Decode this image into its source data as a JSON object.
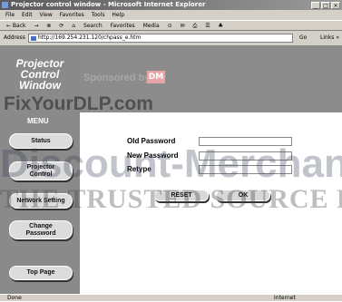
{
  "window": {
    "title": "Projector control window - Microsoft Internet Explorer",
    "controls": [
      "_",
      "□",
      "×"
    ]
  },
  "menubar": [
    "File",
    "Edit",
    "View",
    "Favorites",
    "Tools",
    "Help"
  ],
  "toolbar": [
    "← Back",
    "→",
    "⊗",
    "⟳",
    "⌂",
    "Search",
    "Favorites",
    "Media",
    "⊙",
    "✉",
    "⎙",
    "☰",
    "♣"
  ],
  "address": {
    "label": "Address",
    "url": "http://169.254.231.120/chpass_e.htm",
    "go_label": "Go",
    "links_label": "Links »"
  },
  "page": {
    "title_lines": [
      "Projector",
      "Control",
      "Window"
    ],
    "sponsored_text": "Sponsored by",
    "sponsor_logo": "DM",
    "menu_label": "MENU",
    "nav": [
      {
        "label": "Status"
      },
      {
        "label": "Projector Control"
      },
      {
        "label": "Network Setting"
      },
      {
        "label": "Change Password"
      },
      {
        "label": "Top Page"
      }
    ],
    "form": {
      "old_password_label": "Old Password",
      "new_password_label": "New Password",
      "retype_label": "Retype",
      "reset_label": "RESET",
      "ok_label": "OK"
    }
  },
  "watermarks": [
    "FixYourDLP.com",
    "Discount-Merchant",
    "THE TRUSTED SOURCE FOR"
  ],
  "status": {
    "left": "Done",
    "zone": "Internet"
  }
}
